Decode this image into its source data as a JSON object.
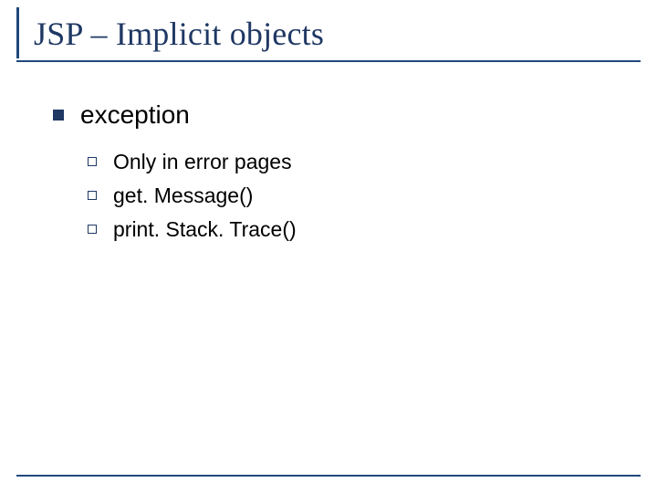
{
  "slide": {
    "title": "JSP – Implicit objects",
    "level1": {
      "text": "exception"
    },
    "level2": [
      {
        "text": "Only in error pages"
      },
      {
        "text": "get. Message()"
      },
      {
        "text": "print. Stack. Trace()"
      }
    ]
  }
}
